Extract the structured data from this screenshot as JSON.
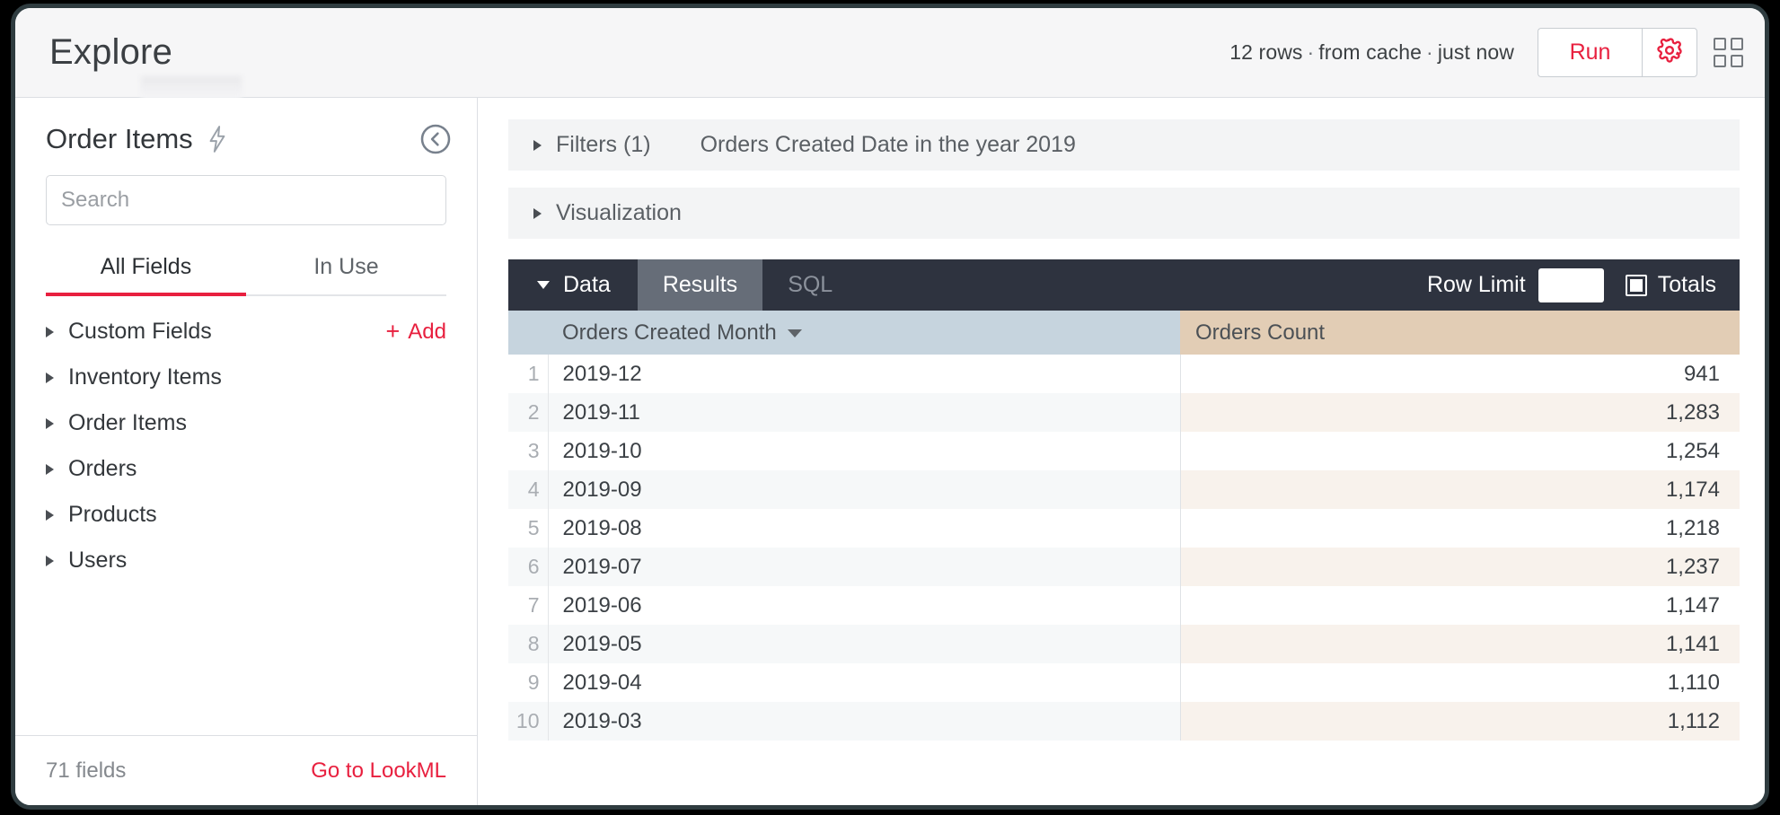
{
  "header": {
    "title": "Explore",
    "status": {
      "rows": "12 rows",
      "source": "from cache",
      "time": "just now",
      "separator": "·"
    },
    "run_label": "Run",
    "settings_icon": "gear-icon",
    "grid_icon": "grid-icon"
  },
  "sidebar": {
    "explore_name": "Order Items",
    "lightning_icon": "lightning-bolt-icon",
    "collapse_icon": "chevron-left-circle-icon",
    "search": {
      "value": "",
      "placeholder": "Search"
    },
    "tabs": [
      {
        "label": "All Fields",
        "active": true
      },
      {
        "label": "In Use",
        "active": false
      }
    ],
    "add_link": {
      "plus": "+",
      "label": "Add"
    },
    "groups": [
      {
        "label": "Custom Fields"
      },
      {
        "label": "Inventory Items"
      },
      {
        "label": "Order Items"
      },
      {
        "label": "Orders"
      },
      {
        "label": "Products"
      },
      {
        "label": "Users"
      }
    ],
    "footer": {
      "field_count": "71 fields",
      "lookml_link": "Go to LookML"
    }
  },
  "main": {
    "filters": {
      "label": "Filters (1)",
      "expression": "Orders Created Date in the year 2019"
    },
    "visualization": {
      "label": "Visualization"
    },
    "data_bar": {
      "data_label": "Data",
      "tabs": [
        {
          "label": "Results",
          "active": true
        },
        {
          "label": "SQL",
          "active": false
        }
      ],
      "row_limit_label": "Row Limit",
      "row_limit_value": "",
      "totals_label": "Totals",
      "totals_checked": false
    }
  },
  "chart_data": {
    "type": "table",
    "title": "Orders Created Month by Orders Count",
    "columns": [
      "Orders Created Month",
      "Orders Count"
    ],
    "sort": {
      "column": "Orders Created Month",
      "direction": "desc"
    },
    "rows": [
      {
        "index": "1",
        "month": "2019-12",
        "count": "941"
      },
      {
        "index": "2",
        "month": "2019-11",
        "count": "1,283"
      },
      {
        "index": "3",
        "month": "2019-10",
        "count": "1,254"
      },
      {
        "index": "4",
        "month": "2019-09",
        "count": "1,174"
      },
      {
        "index": "5",
        "month": "2019-08",
        "count": "1,218"
      },
      {
        "index": "6",
        "month": "2019-07",
        "count": "1,237"
      },
      {
        "index": "7",
        "month": "2019-06",
        "count": "1,147"
      },
      {
        "index": "8",
        "month": "2019-05",
        "count": "1,141"
      },
      {
        "index": "9",
        "month": "2019-04",
        "count": "1,110"
      },
      {
        "index": "10",
        "month": "2019-03",
        "count": "1,112"
      }
    ],
    "categories": [
      "2019-12",
      "2019-11",
      "2019-10",
      "2019-09",
      "2019-08",
      "2019-07",
      "2019-06",
      "2019-05",
      "2019-04",
      "2019-03"
    ],
    "values": [
      941,
      1283,
      1254,
      1174,
      1218,
      1237,
      1147,
      1141,
      1110,
      1112
    ],
    "xlabel": "Orders Created Month",
    "ylabel": "Orders Count"
  },
  "colors": {
    "brand_red": "#e8203f",
    "dark_bar": "#2e333f",
    "dimension_header": "#c6d4de",
    "measure_header": "#e2cdb5",
    "measure_row_alt": "#f8f2ec"
  }
}
